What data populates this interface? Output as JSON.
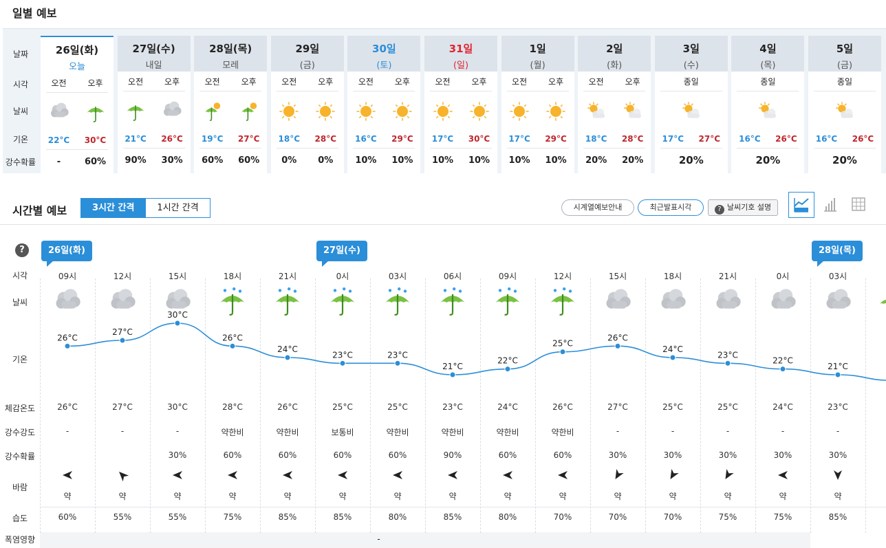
{
  "daily": {
    "title": "일별 예보",
    "labels": {
      "date": "날짜",
      "time": "시각",
      "weather": "날씨",
      "temp": "기온",
      "pop": "강수확률"
    },
    "days": [
      {
        "day": "26일(화)",
        "sub": "오늘",
        "sub_color": "blue",
        "split": true,
        "am_label": "오전",
        "pm_label": "오후",
        "am_icon": "cloud",
        "pm_icon": "umbrella",
        "min": "22°C",
        "max": "30°C",
        "am_pop": "-",
        "pm_pop": "60%"
      },
      {
        "day": "27일(수)",
        "sub": "내일",
        "split": true,
        "am_label": "오전",
        "pm_label": "오후",
        "am_icon": "umbrella",
        "pm_icon": "cloud",
        "min": "21°C",
        "max": "26°C",
        "am_pop": "90%",
        "pm_pop": "30%"
      },
      {
        "day": "28일(목)",
        "sub": "모레",
        "split": true,
        "am_label": "오전",
        "pm_label": "오후",
        "am_icon": "sun-umbrella",
        "pm_icon": "sun-umbrella",
        "min": "19°C",
        "max": "27°C",
        "am_pop": "60%",
        "pm_pop": "60%"
      },
      {
        "day": "29일",
        "sub": "(금)",
        "split": true,
        "am_label": "오전",
        "pm_label": "오후",
        "am_icon": "sun",
        "pm_icon": "sun",
        "min": "18°C",
        "max": "28°C",
        "am_pop": "0%",
        "pm_pop": "0%"
      },
      {
        "day": "30일",
        "sub": "(토)",
        "day_color": "blue",
        "sub_color": "blue",
        "split": true,
        "am_label": "오전",
        "pm_label": "오후",
        "am_icon": "sun",
        "pm_icon": "sun",
        "min": "16°C",
        "max": "29°C",
        "am_pop": "10%",
        "pm_pop": "10%"
      },
      {
        "day": "31일",
        "sub": "(일)",
        "day_color": "red",
        "sub_color": "red",
        "split": true,
        "am_label": "오전",
        "pm_label": "오후",
        "am_icon": "sun",
        "pm_icon": "sun",
        "min": "17°C",
        "max": "30°C",
        "am_pop": "10%",
        "pm_pop": "10%"
      },
      {
        "day": "1일",
        "sub": "(월)",
        "split": true,
        "am_label": "오전",
        "pm_label": "오후",
        "am_icon": "sun",
        "pm_icon": "sun",
        "min": "17°C",
        "max": "29°C",
        "am_pop": "10%",
        "pm_pop": "10%"
      },
      {
        "day": "2일",
        "sub": "(화)",
        "split": true,
        "am_label": "오전",
        "pm_label": "오후",
        "am_icon": "sun-cloud",
        "pm_icon": "sun-cloud",
        "min": "18°C",
        "max": "28°C",
        "am_pop": "20%",
        "pm_pop": "20%"
      },
      {
        "day": "3일",
        "sub": "(수)",
        "split": false,
        "all_label": "종일",
        "all_icon": "sun-cloud",
        "min": "17°C",
        "max": "27°C",
        "all_pop": "20%"
      },
      {
        "day": "4일",
        "sub": "(목)",
        "split": false,
        "all_label": "종일",
        "all_icon": "sun-cloud",
        "min": "16°C",
        "max": "26°C",
        "all_pop": "20%"
      },
      {
        "day": "5일",
        "sub": "(금)",
        "split": false,
        "all_label": "종일",
        "all_icon": "sun-cloud",
        "min": "16°C",
        "max": "26°C",
        "all_pop": "20%"
      }
    ]
  },
  "hourly": {
    "title": "시간별 예보",
    "tabs": [
      {
        "label": "3시간 간격",
        "active": true
      },
      {
        "label": "1시간 간격",
        "active": false
      }
    ],
    "buttons": {
      "guide": "시계열예보안내",
      "latest": "최근발표시각",
      "legend": "날씨기호 설명"
    },
    "view_icons": [
      "line-chart-icon",
      "bar-chart-icon",
      "table-icon"
    ],
    "help": "?",
    "labels": {
      "time": "시각",
      "weather": "날씨",
      "temp": "기온",
      "feels": "체감온도",
      "intensity": "강수강도",
      "pop": "강수확률",
      "wind": "바람",
      "humidity": "습도",
      "heat": "폭염영향"
    },
    "date_badges": [
      {
        "label": "26일(화)",
        "col": 0
      },
      {
        "label": "27일(수)",
        "col": 5
      },
      {
        "label": "28일(목)",
        "col": 14
      }
    ],
    "heat_value": "-",
    "colors": {
      "accent": "#2b8ed8",
      "max_temp": "#c0262d"
    },
    "slots": [
      {
        "time": "09시",
        "icon": "cloud",
        "temp": 26,
        "temp_label": "26°C",
        "feels": "26°C",
        "intensity": "-",
        "pop": "",
        "wind_dir": 180,
        "wind": "약",
        "humidity": "60%"
      },
      {
        "time": "12시",
        "icon": "cloud",
        "temp": 27,
        "temp_label": "27°C",
        "feels": "27°C",
        "intensity": "-",
        "pop": "",
        "wind_dir": 225,
        "wind": "약",
        "humidity": "55%"
      },
      {
        "time": "15시",
        "icon": "cloud",
        "temp": 30,
        "temp_label": "30°C",
        "feels": "30°C",
        "intensity": "-",
        "pop": "30%",
        "wind_dir": 180,
        "wind": "약",
        "humidity": "55%"
      },
      {
        "time": "18시",
        "icon": "umbrella",
        "temp": 26,
        "temp_label": "26°C",
        "feels": "28°C",
        "intensity": "약한비",
        "pop": "60%",
        "wind_dir": 180,
        "wind": "약",
        "humidity": "75%"
      },
      {
        "time": "21시",
        "icon": "umbrella",
        "temp": 24,
        "temp_label": "24°C",
        "feels": "26°C",
        "intensity": "약한비",
        "pop": "60%",
        "wind_dir": 180,
        "wind": "약",
        "humidity": "85%"
      },
      {
        "time": "0시",
        "icon": "umbrella",
        "temp": 23,
        "temp_label": "23°C",
        "feels": "25°C",
        "intensity": "보통비",
        "pop": "60%",
        "wind_dir": 180,
        "wind": "약",
        "humidity": "85%"
      },
      {
        "time": "03시",
        "icon": "umbrella",
        "temp": 23,
        "temp_label": "23°C",
        "feels": "25°C",
        "intensity": "약한비",
        "pop": "60%",
        "wind_dir": 180,
        "wind": "약",
        "humidity": "80%"
      },
      {
        "time": "06시",
        "icon": "umbrella",
        "temp": 21,
        "temp_label": "21°C",
        "feels": "23°C",
        "intensity": "약한비",
        "pop": "90%",
        "wind_dir": 180,
        "wind": "약",
        "humidity": "85%"
      },
      {
        "time": "09시",
        "icon": "umbrella",
        "temp": 22,
        "temp_label": "22°C",
        "feels": "24°C",
        "intensity": "약한비",
        "pop": "60%",
        "wind_dir": 180,
        "wind": "약",
        "humidity": "80%"
      },
      {
        "time": "12시",
        "icon": "umbrella",
        "temp": 25,
        "temp_label": "25°C",
        "feels": "26°C",
        "intensity": "약한비",
        "pop": "60%",
        "wind_dir": 180,
        "wind": "약",
        "humidity": "70%"
      },
      {
        "time": "15시",
        "icon": "cloud",
        "temp": 26,
        "temp_label": "26°C",
        "feels": "27°C",
        "intensity": "-",
        "pop": "30%",
        "wind_dir": 120,
        "wind": "약",
        "humidity": "70%"
      },
      {
        "time": "18시",
        "icon": "cloud",
        "temp": 24,
        "temp_label": "24°C",
        "feels": "25°C",
        "intensity": "-",
        "pop": "30%",
        "wind_dir": 120,
        "wind": "약",
        "humidity": "70%"
      },
      {
        "time": "21시",
        "icon": "cloud",
        "temp": 23,
        "temp_label": "23°C",
        "feels": "25°C",
        "intensity": "-",
        "pop": "30%",
        "wind_dir": 120,
        "wind": "약",
        "humidity": "75%"
      },
      {
        "time": "0시",
        "icon": "cloud",
        "temp": 22,
        "temp_label": "22°C",
        "feels": "24°C",
        "intensity": "-",
        "pop": "30%",
        "wind_dir": 180,
        "wind": "약",
        "humidity": "75%"
      },
      {
        "time": "03시",
        "icon": "cloud",
        "temp": 21,
        "temp_label": "21°C",
        "feels": "23°C",
        "intensity": "-",
        "pop": "30%",
        "wind_dir": 90,
        "wind": "약",
        "humidity": "85%"
      }
    ]
  }
}
